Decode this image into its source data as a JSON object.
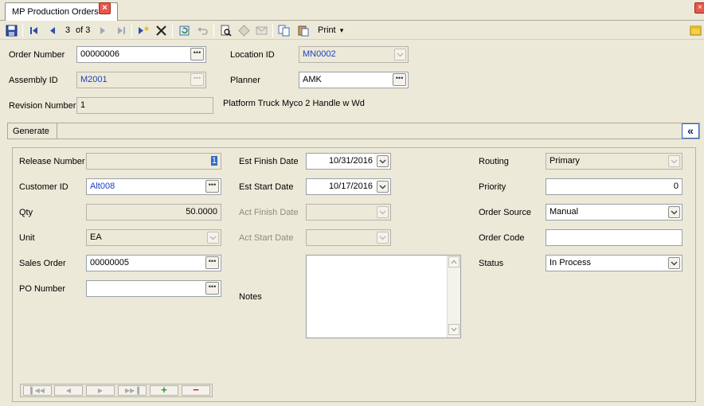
{
  "tab": {
    "title": "MP Production Orders",
    "close": "×"
  },
  "window_close": "×",
  "toolbar": {
    "record_position": "3",
    "record_of": "of 3",
    "print_label": "Print",
    "print_arrow": "▾"
  },
  "header": {
    "order_number": {
      "label": "Order Number",
      "value": "00000006"
    },
    "location_id": {
      "label": "Location ID",
      "value": "MN0002"
    },
    "assembly_id": {
      "label": "Assembly ID",
      "value": "M2001"
    },
    "planner": {
      "label": "Planner",
      "value": "AMK"
    },
    "revision_number": {
      "label": "Revision Number",
      "value": "1"
    },
    "assembly_description": "Platform Truck Myco 2 Handle w Wd"
  },
  "group": {
    "tab_label": "Generate",
    "collapse_label": "«"
  },
  "generate": {
    "release_number": {
      "label": "Release Number",
      "value": "1"
    },
    "customer_id": {
      "label": "Customer ID",
      "value": "Alt008"
    },
    "qty": {
      "label": "Qty",
      "value": "50.0000"
    },
    "unit": {
      "label": "Unit",
      "value": "EA"
    },
    "sales_order": {
      "label": "Sales Order",
      "value": "00000005"
    },
    "po_number": {
      "label": "PO Number",
      "value": ""
    },
    "est_finish_date": {
      "label": "Est Finish Date",
      "value": "10/31/2016"
    },
    "est_start_date": {
      "label": "Est Start Date",
      "value": "10/17/2016"
    },
    "act_finish_date": {
      "label": "Act Finish Date",
      "value": ""
    },
    "act_start_date": {
      "label": "Act Start Date",
      "value": ""
    },
    "notes": {
      "label": "Notes",
      "value": ""
    },
    "routing": {
      "label": "Routing",
      "value": "Primary"
    },
    "priority": {
      "label": "Priority",
      "value": "0"
    },
    "order_source": {
      "label": "Order Source",
      "value": "Manual"
    },
    "order_code": {
      "label": "Order Code",
      "value": ""
    },
    "status": {
      "label": "Status",
      "value": "In Process"
    }
  },
  "navigator": {
    "add": "+",
    "remove": "−"
  },
  "colors": {
    "accent_blue": "#1f3fbf",
    "selection": "#316ac5",
    "close_red": "#e8584a"
  }
}
